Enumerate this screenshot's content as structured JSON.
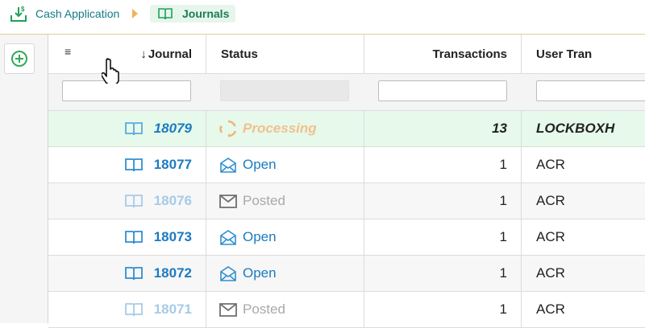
{
  "breadcrumb": {
    "items": [
      {
        "label": "Cash Application",
        "icon": "cash-download-icon"
      },
      {
        "label": "Journals",
        "icon": "journal-book-icon"
      }
    ]
  },
  "sidebar": {
    "add_icon": "plus-circle-icon"
  },
  "grid": {
    "columns": [
      {
        "label": "Journal",
        "sort": "descending",
        "menu_icon": "hamburger-menu-icon"
      },
      {
        "label": "Status"
      },
      {
        "label": "Transactions"
      },
      {
        "label": "User Tran"
      }
    ],
    "filters": [
      "",
      "",
      "",
      ""
    ],
    "rows": [
      {
        "journal": "18079",
        "status": "Processing",
        "status_icon": "processing-arrows-icon",
        "transactions": "13",
        "user_tran": "LOCKBOXH",
        "state": "selected"
      },
      {
        "journal": "18077",
        "status": "Open",
        "status_icon": "open-envelope-icon",
        "transactions": "1",
        "user_tran": "ACR",
        "state": "open"
      },
      {
        "journal": "18076",
        "status": "Posted",
        "status_icon": "closed-envelope-icon",
        "transactions": "1",
        "user_tran": "ACR",
        "state": "posted"
      },
      {
        "journal": "18073",
        "status": "Open",
        "status_icon": "open-envelope-icon",
        "transactions": "1",
        "user_tran": "ACR",
        "state": "open"
      },
      {
        "journal": "18072",
        "status": "Open",
        "status_icon": "open-envelope-icon",
        "transactions": "1",
        "user_tran": "ACR",
        "state": "open"
      },
      {
        "journal": "18071",
        "status": "Posted",
        "status_icon": "closed-envelope-icon",
        "transactions": "1",
        "user_tran": "ACR",
        "state": "posted"
      }
    ]
  },
  "colors": {
    "accent": "#1c7bc1",
    "processing": "#f2c08d",
    "selected_row": "#e6f9ea",
    "breadcrumb_active": "#e6f6ec"
  }
}
